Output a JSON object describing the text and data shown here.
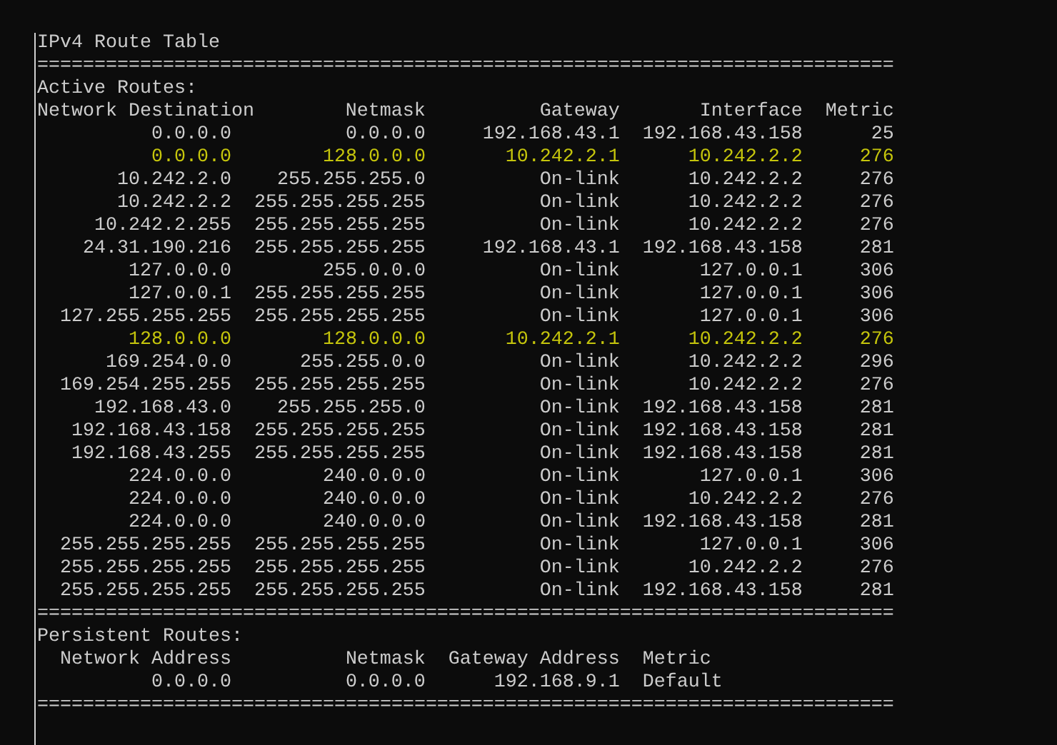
{
  "title": "IPv4 Route Table",
  "separator": "===========================================================================",
  "active_routes": {
    "heading": "Active Routes:",
    "columns": [
      "Network Destination",
      "Netmask",
      "Gateway",
      "Interface",
      "Metric"
    ],
    "rows": [
      {
        "destination": "0.0.0.0",
        "netmask": "0.0.0.0",
        "gateway": "192.168.43.1",
        "interface": "192.168.43.158",
        "metric": "25",
        "highlighted": false
      },
      {
        "destination": "0.0.0.0",
        "netmask": "128.0.0.0",
        "gateway": "10.242.2.1",
        "interface": "10.242.2.2",
        "metric": "276",
        "highlighted": true
      },
      {
        "destination": "10.242.2.0",
        "netmask": "255.255.255.0",
        "gateway": "On-link",
        "interface": "10.242.2.2",
        "metric": "276",
        "highlighted": false
      },
      {
        "destination": "10.242.2.2",
        "netmask": "255.255.255.255",
        "gateway": "On-link",
        "interface": "10.242.2.2",
        "metric": "276",
        "highlighted": false
      },
      {
        "destination": "10.242.2.255",
        "netmask": "255.255.255.255",
        "gateway": "On-link",
        "interface": "10.242.2.2",
        "metric": "276",
        "highlighted": false
      },
      {
        "destination": "24.31.190.216",
        "netmask": "255.255.255.255",
        "gateway": "192.168.43.1",
        "interface": "192.168.43.158",
        "metric": "281",
        "highlighted": false
      },
      {
        "destination": "127.0.0.0",
        "netmask": "255.0.0.0",
        "gateway": "On-link",
        "interface": "127.0.0.1",
        "metric": "306",
        "highlighted": false
      },
      {
        "destination": "127.0.0.1",
        "netmask": "255.255.255.255",
        "gateway": "On-link",
        "interface": "127.0.0.1",
        "metric": "306",
        "highlighted": false
      },
      {
        "destination": "127.255.255.255",
        "netmask": "255.255.255.255",
        "gateway": "On-link",
        "interface": "127.0.0.1",
        "metric": "306",
        "highlighted": false
      },
      {
        "destination": "128.0.0.0",
        "netmask": "128.0.0.0",
        "gateway": "10.242.2.1",
        "interface": "10.242.2.2",
        "metric": "276",
        "highlighted": true
      },
      {
        "destination": "169.254.0.0",
        "netmask": "255.255.0.0",
        "gateway": "On-link",
        "interface": "10.242.2.2",
        "metric": "296",
        "highlighted": false
      },
      {
        "destination": "169.254.255.255",
        "netmask": "255.255.255.255",
        "gateway": "On-link",
        "interface": "10.242.2.2",
        "metric": "276",
        "highlighted": false
      },
      {
        "destination": "192.168.43.0",
        "netmask": "255.255.255.0",
        "gateway": "On-link",
        "interface": "192.168.43.158",
        "metric": "281",
        "highlighted": false
      },
      {
        "destination": "192.168.43.158",
        "netmask": "255.255.255.255",
        "gateway": "On-link",
        "interface": "192.168.43.158",
        "metric": "281",
        "highlighted": false
      },
      {
        "destination": "192.168.43.255",
        "netmask": "255.255.255.255",
        "gateway": "On-link",
        "interface": "192.168.43.158",
        "metric": "281",
        "highlighted": false
      },
      {
        "destination": "224.0.0.0",
        "netmask": "240.0.0.0",
        "gateway": "On-link",
        "interface": "127.0.0.1",
        "metric": "306",
        "highlighted": false
      },
      {
        "destination": "224.0.0.0",
        "netmask": "240.0.0.0",
        "gateway": "On-link",
        "interface": "10.242.2.2",
        "metric": "276",
        "highlighted": false
      },
      {
        "destination": "224.0.0.0",
        "netmask": "240.0.0.0",
        "gateway": "On-link",
        "interface": "192.168.43.158",
        "metric": "281",
        "highlighted": false
      },
      {
        "destination": "255.255.255.255",
        "netmask": "255.255.255.255",
        "gateway": "On-link",
        "interface": "127.0.0.1",
        "metric": "306",
        "highlighted": false
      },
      {
        "destination": "255.255.255.255",
        "netmask": "255.255.255.255",
        "gateway": "On-link",
        "interface": "10.242.2.2",
        "metric": "276",
        "highlighted": false
      },
      {
        "destination": "255.255.255.255",
        "netmask": "255.255.255.255",
        "gateway": "On-link",
        "interface": "192.168.43.158",
        "metric": "281",
        "highlighted": false
      }
    ]
  },
  "persistent_routes": {
    "heading": "Persistent Routes:",
    "columns": [
      "Network Address",
      "Netmask",
      "Gateway Address",
      "Metric"
    ],
    "rows": [
      {
        "address": "0.0.0.0",
        "netmask": "0.0.0.0",
        "gateway": "192.168.9.1",
        "metric": "Default"
      }
    ]
  }
}
